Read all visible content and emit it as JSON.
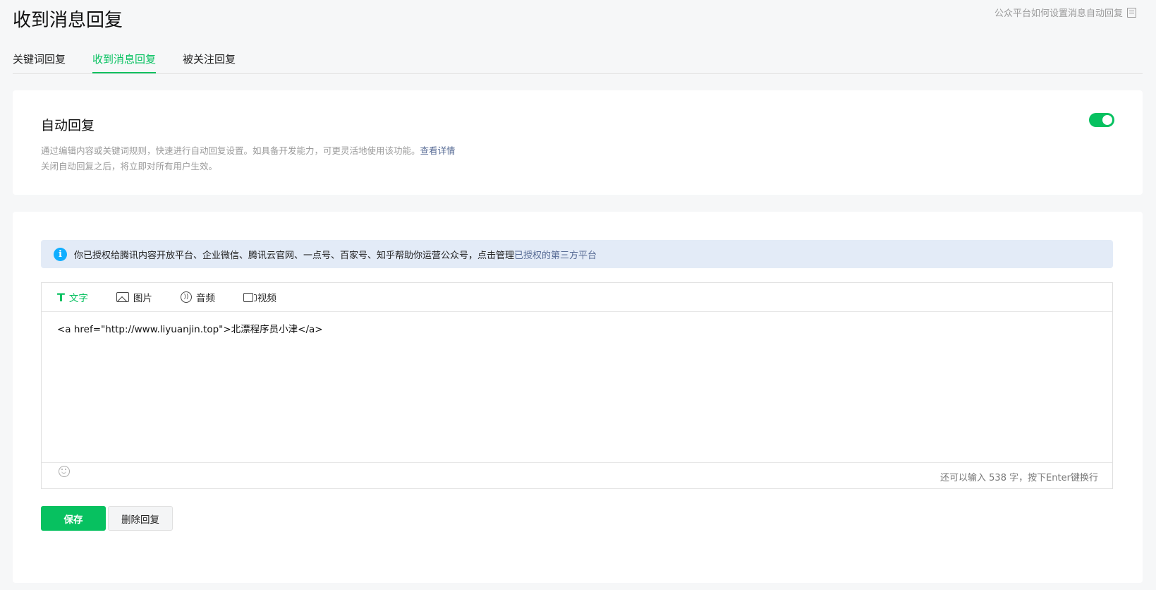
{
  "page": {
    "title": "收到消息回复",
    "help_link": "公众平台如何设置消息自动回复"
  },
  "tabs": [
    {
      "label": "关键词回复",
      "active": false
    },
    {
      "label": "收到消息回复",
      "active": true
    },
    {
      "label": "被关注回复",
      "active": false
    }
  ],
  "auto_reply": {
    "title": "自动回复",
    "enabled": true,
    "desc_line1": "通过编辑内容或关键词规则，快速进行自动回复设置。如具备开发能力，可更灵活地使用该功能。",
    "details_link": "查看详情",
    "desc_line2": "关闭自动回复之后，将立即对所有用户生效。"
  },
  "notice": {
    "text": "你已授权给腾讯内容开放平台、企业微信、腾讯云官网、一点号、百家号、知乎帮助你运营公众号，点击管理",
    "link": "已授权的第三方平台"
  },
  "editor": {
    "tools": [
      {
        "label": "文字",
        "icon": "text-icon",
        "active": true
      },
      {
        "label": "图片",
        "icon": "image-icon",
        "active": false
      },
      {
        "label": "音频",
        "icon": "audio-icon",
        "active": false
      },
      {
        "label": "视频",
        "icon": "video-icon",
        "active": false
      }
    ],
    "content": "<a href=\"http://www.liyuanjin.top\">北漂程序员小津</a>",
    "counter": "还可以输入 538 字，按下Enter键换行"
  },
  "actions": {
    "save": "保存",
    "delete": "删除回复"
  },
  "colors": {
    "accent": "#07c160",
    "link": "#576b95",
    "notice_bg": "#e3ebf7",
    "info": "#10aeff"
  }
}
